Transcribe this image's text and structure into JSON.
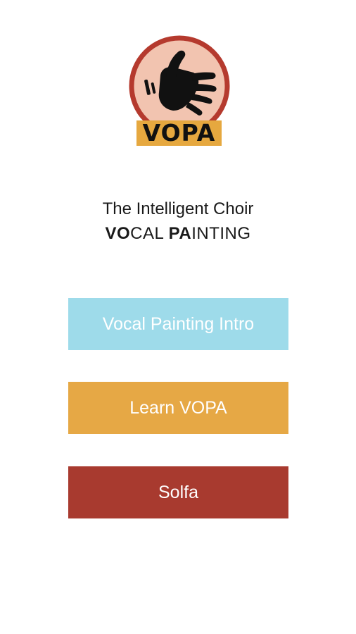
{
  "logo": {
    "badge_text": "VOPA",
    "icon": "hand-icon",
    "ring_color": "#b53a2e",
    "fill_color": "#f2c4b0",
    "badge_color": "#e6a83f"
  },
  "tagline": {
    "line1": "The Intelligent Choir",
    "line2_part1_bold": "VO",
    "line2_part2": "CAL ",
    "line2_part3_bold": "PA",
    "line2_part4": "INTING"
  },
  "menu": {
    "intro_label": "Vocal Painting Intro",
    "learn_label": "Learn VOPA",
    "solfa_label": "Solfa",
    "intro_color": "#9edbea",
    "learn_color": "#e6a845",
    "solfa_color": "#a83a2f"
  }
}
